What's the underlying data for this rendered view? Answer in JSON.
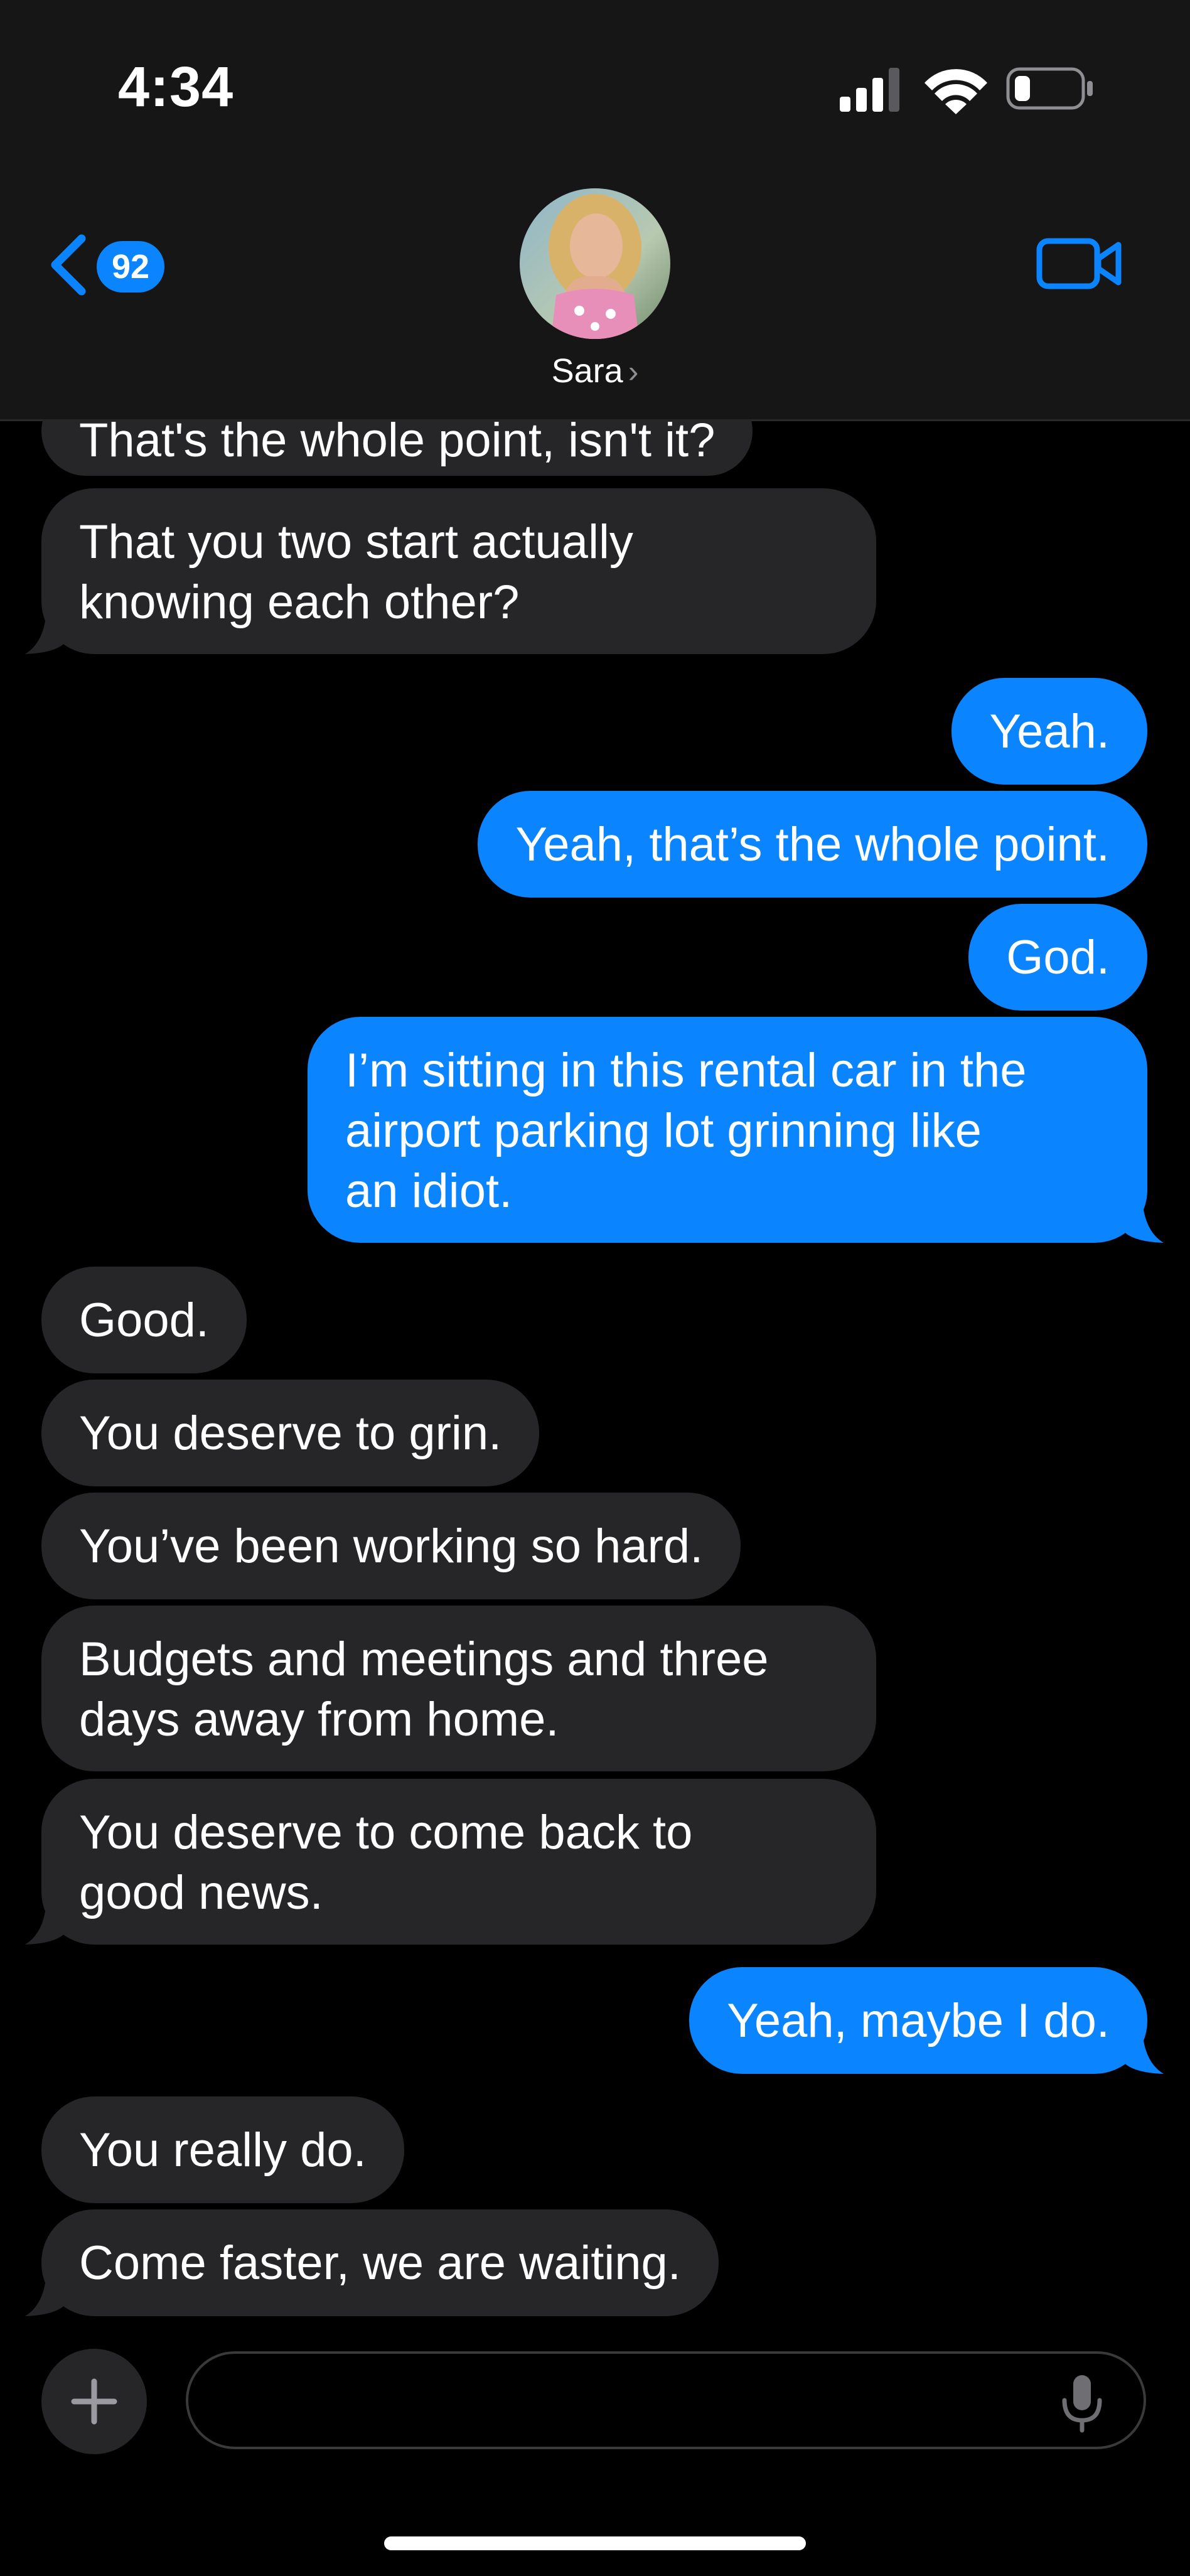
{
  "status_bar": {
    "time": "4:34",
    "icons": [
      "cellular-signal-icon",
      "wifi-icon",
      "battery-icon"
    ]
  },
  "header": {
    "back_badge_count": "92",
    "contact_name": "Sara",
    "name_chevron": "›",
    "icons": [
      "back-chevron-icon",
      "video-camera-icon"
    ]
  },
  "messages": [
    {
      "sender": "them",
      "text": "That's the whole point, isn't it?"
    },
    {
      "sender": "them",
      "text": "That you two start actually\nknowing each other?"
    },
    {
      "sender": "me",
      "text": "Yeah."
    },
    {
      "sender": "me",
      "text": "Yeah, that’s the whole point."
    },
    {
      "sender": "me",
      "text": "God."
    },
    {
      "sender": "me",
      "text": "I’m sitting in this rental car in the\nairport parking lot grinning like\nan idiot."
    },
    {
      "sender": "them",
      "text": "Good."
    },
    {
      "sender": "them",
      "text": "You deserve to grin."
    },
    {
      "sender": "them",
      "text": "You’ve been working so hard."
    },
    {
      "sender": "them",
      "text": "Budgets and meetings and three\ndays away from home."
    },
    {
      "sender": "them",
      "text": "You deserve to come back to\ngood news."
    },
    {
      "sender": "me",
      "text": "Yeah, maybe I do."
    },
    {
      "sender": "them",
      "text": "You really do."
    },
    {
      "sender": "them",
      "text": "Come faster, we are waiting."
    }
  ],
  "composer": {
    "value": "",
    "placeholder": "",
    "icons": [
      "plus-icon",
      "microphone-icon"
    ]
  },
  "colors": {
    "accent": "#0a84ff",
    "incoming_bubble": "#262628",
    "background": "#000000",
    "header_background": "#161616"
  }
}
